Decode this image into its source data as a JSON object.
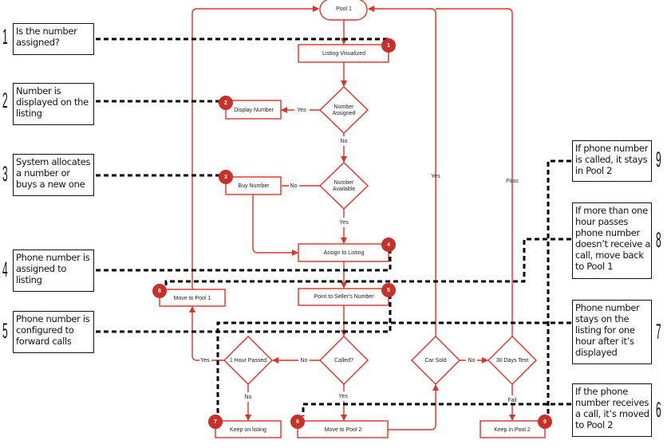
{
  "colors": {
    "flow": "#d9342b",
    "badge": "#c8302a",
    "annotation_line": "#000000"
  },
  "nodes": {
    "pool1": "Pool 1",
    "listing_visualized": "Listing Visualized",
    "number_assigned": [
      "Number",
      "Assigned"
    ],
    "display_number": "Display Number",
    "number_available": [
      "Number",
      "Available"
    ],
    "buy_number": "Buy Number",
    "assign_to_listing": "Assign to Listing",
    "point_to_sellers_number": "Point to Seller's Number",
    "move_to_pool1": "Move to Pool 1",
    "called": "Called?",
    "one_hour_passed": "1 Hour Passed",
    "car_sold": "Car Sold",
    "thirty_days_test": "30 Days Test",
    "keep_on_listing": "Keep on listing",
    "move_to_pool2": "Move to Pool 2",
    "keep_in_pool2": "Keep in Pool 2"
  },
  "edge_labels": {
    "assigned_yes": "Yes",
    "assigned_no": "No",
    "available_no": "No",
    "available_yes": "Yes",
    "called_no": "No",
    "called_yes": "Yes",
    "hour_yes": "Yes",
    "hour_no": "No",
    "carsold_no": "No",
    "carsold_yes": "Yes",
    "test_pass": "Pass",
    "test_fail": "Fail"
  },
  "badges": [
    "1",
    "2",
    "3",
    "4",
    "5",
    "6",
    "7",
    "8",
    "9"
  ],
  "annotations": {
    "a1": {
      "num": "1",
      "lines": [
        "Is the number",
        "assigned?"
      ]
    },
    "a2": {
      "num": "2",
      "lines": [
        "Number is",
        "displayed on the",
        "listing"
      ]
    },
    "a3": {
      "num": "3",
      "lines": [
        "System allocates",
        "a number or",
        "buys a new one"
      ]
    },
    "a4": {
      "num": "4",
      "lines": [
        "Phone number is",
        "assigned to",
        "listing"
      ]
    },
    "a5": {
      "num": "5",
      "lines": [
        "Phone number is",
        "configured to",
        "forward calls"
      ]
    },
    "a9": {
      "num": "9",
      "lines": [
        "If phone number",
        "is called, it stays",
        "in Pool 2"
      ]
    },
    "a8": {
      "num": "8",
      "lines": [
        "If more than one",
        "hour passes",
        "phone number",
        "doesn’t receive a",
        "call, move back",
        "to Pool 1"
      ]
    },
    "a7": {
      "num": "7",
      "lines": [
        "Phone number",
        "stays on the",
        "listing for one",
        "hour after it’s",
        "displayed"
      ]
    },
    "a6": {
      "num": "6",
      "lines": [
        "If the phone",
        "number receives",
        "a call, it’s moved",
        "to Pool 2"
      ]
    }
  }
}
